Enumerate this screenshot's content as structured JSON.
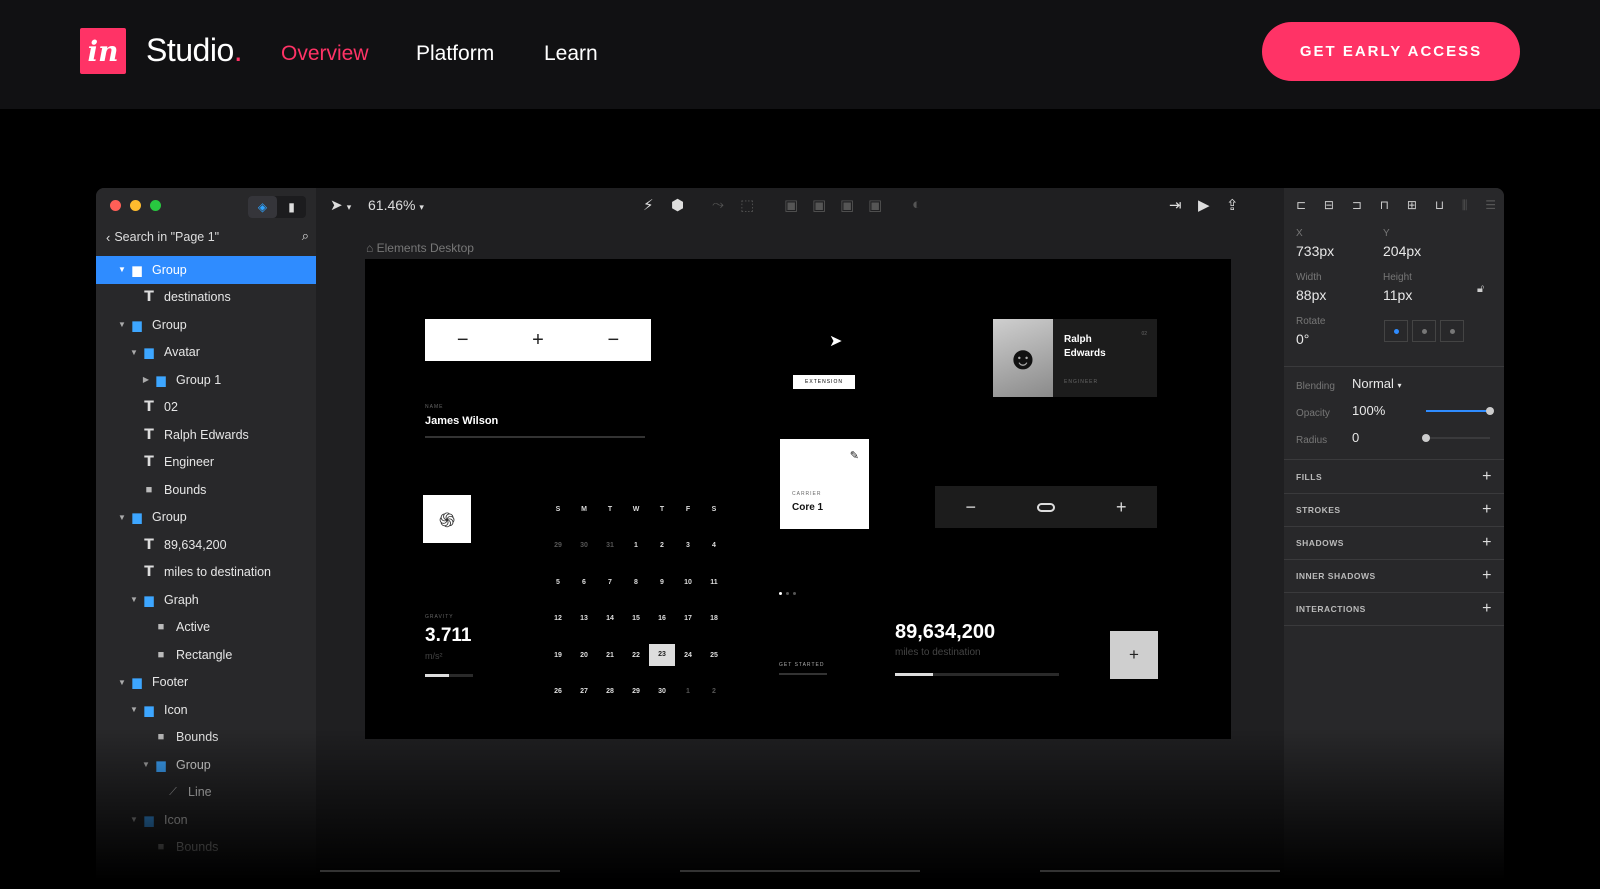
{
  "site": {
    "logo_mark": "in",
    "brand": "Studio",
    "brand_dot": ".",
    "nav": [
      "Overview",
      "Platform",
      "Learn"
    ],
    "active_nav": "Overview",
    "cta": "GET EARLY ACCESS",
    "accent": "#ff3366"
  },
  "left_panel": {
    "search_label": "Search in \"Page 1\"",
    "layers": [
      {
        "label": "Group",
        "type": "folder",
        "depth": 0,
        "expanded": true,
        "selected": true
      },
      {
        "label": "destinations",
        "type": "text",
        "depth": 1
      },
      {
        "label": "Group",
        "type": "folder",
        "depth": 0,
        "expanded": true
      },
      {
        "label": "Avatar",
        "type": "folder",
        "depth": 1,
        "expanded": true
      },
      {
        "label": "Group 1",
        "type": "folder",
        "depth": 2,
        "expanded": false
      },
      {
        "label": "02",
        "type": "text",
        "depth": 1
      },
      {
        "label": "Ralph Edwards",
        "type": "text",
        "depth": 1
      },
      {
        "label": "Engineer",
        "type": "text",
        "depth": 1
      },
      {
        "label": "Bounds",
        "type": "rect",
        "depth": 1
      },
      {
        "label": "Group",
        "type": "folder",
        "depth": 0,
        "expanded": true
      },
      {
        "label": "89,634,200",
        "type": "text",
        "depth": 1
      },
      {
        "label": "miles to destination",
        "type": "text",
        "depth": 1
      },
      {
        "label": "Graph",
        "type": "folder",
        "depth": 1,
        "expanded": true
      },
      {
        "label": "Active",
        "type": "rect",
        "depth": 2
      },
      {
        "label": "Rectangle",
        "type": "rect",
        "depth": 2
      },
      {
        "label": "Footer",
        "type": "folder",
        "depth": 0,
        "expanded": true
      },
      {
        "label": "Icon",
        "type": "folder",
        "depth": 1,
        "expanded": true
      },
      {
        "label": "Bounds",
        "type": "rect",
        "depth": 2
      },
      {
        "label": "Group",
        "type": "folder",
        "depth": 2,
        "expanded": true
      },
      {
        "label": "Line",
        "type": "line",
        "depth": 3
      },
      {
        "label": "Icon",
        "type": "folder",
        "depth": 1,
        "expanded": true
      },
      {
        "label": "Bounds",
        "type": "rect",
        "depth": 2
      }
    ]
  },
  "toolbar": {
    "zoom": "61.46%"
  },
  "canvas": {
    "breadcrumb": "Elements Desktop",
    "name_caption": "NAME",
    "name_value": "James Wilson",
    "calendar": {
      "weekdays": [
        "S",
        "M",
        "T",
        "W",
        "T",
        "F",
        "S"
      ],
      "weeks": [
        [
          "29",
          "30",
          "31",
          "1",
          "2",
          "3",
          "4"
        ],
        [
          "5",
          "6",
          "7",
          "8",
          "9",
          "10",
          "11"
        ],
        [
          "12",
          "13",
          "14",
          "15",
          "16",
          "17",
          "18"
        ],
        [
          "19",
          "20",
          "21",
          "22",
          "23",
          "24",
          "25"
        ],
        [
          "26",
          "27",
          "28",
          "29",
          "30",
          "1",
          "2"
        ]
      ],
      "selected": "23"
    },
    "gravity_caption": "GRAVITY",
    "gravity_value": "3.711",
    "gravity_unit": "m/s²",
    "gravity_progress": 0.5,
    "extension_label": "EXTENSION",
    "core_caption": "CARRIER",
    "core_value": "Core 1",
    "get_started": "GET STARTED",
    "profile_name": "Ralph Edwards",
    "profile_num": "02",
    "profile_role": "ENGINEER",
    "distance_value": "89,634,200",
    "distance_sub": "miles to destination",
    "distance_progress": 0.23
  },
  "inspector": {
    "x_label": "X",
    "x_value": "733px",
    "y_label": "Y",
    "y_value": "204px",
    "width_label": "Width",
    "width_value": "88px",
    "height_label": "Height",
    "height_value": "11px",
    "rotate_label": "Rotate",
    "rotate_value": "0°",
    "blending_label": "Blending",
    "blending_value": "Normal",
    "opacity_label": "Opacity",
    "opacity_value": "100%",
    "opacity_level": 1.0,
    "radius_label": "Radius",
    "radius_value": "0",
    "radius_level": 0.0,
    "sections": [
      "FILLS",
      "STROKES",
      "SHADOWS",
      "INNER SHADOWS",
      "INTERACTIONS"
    ],
    "selection_color": "#2f8cff"
  }
}
